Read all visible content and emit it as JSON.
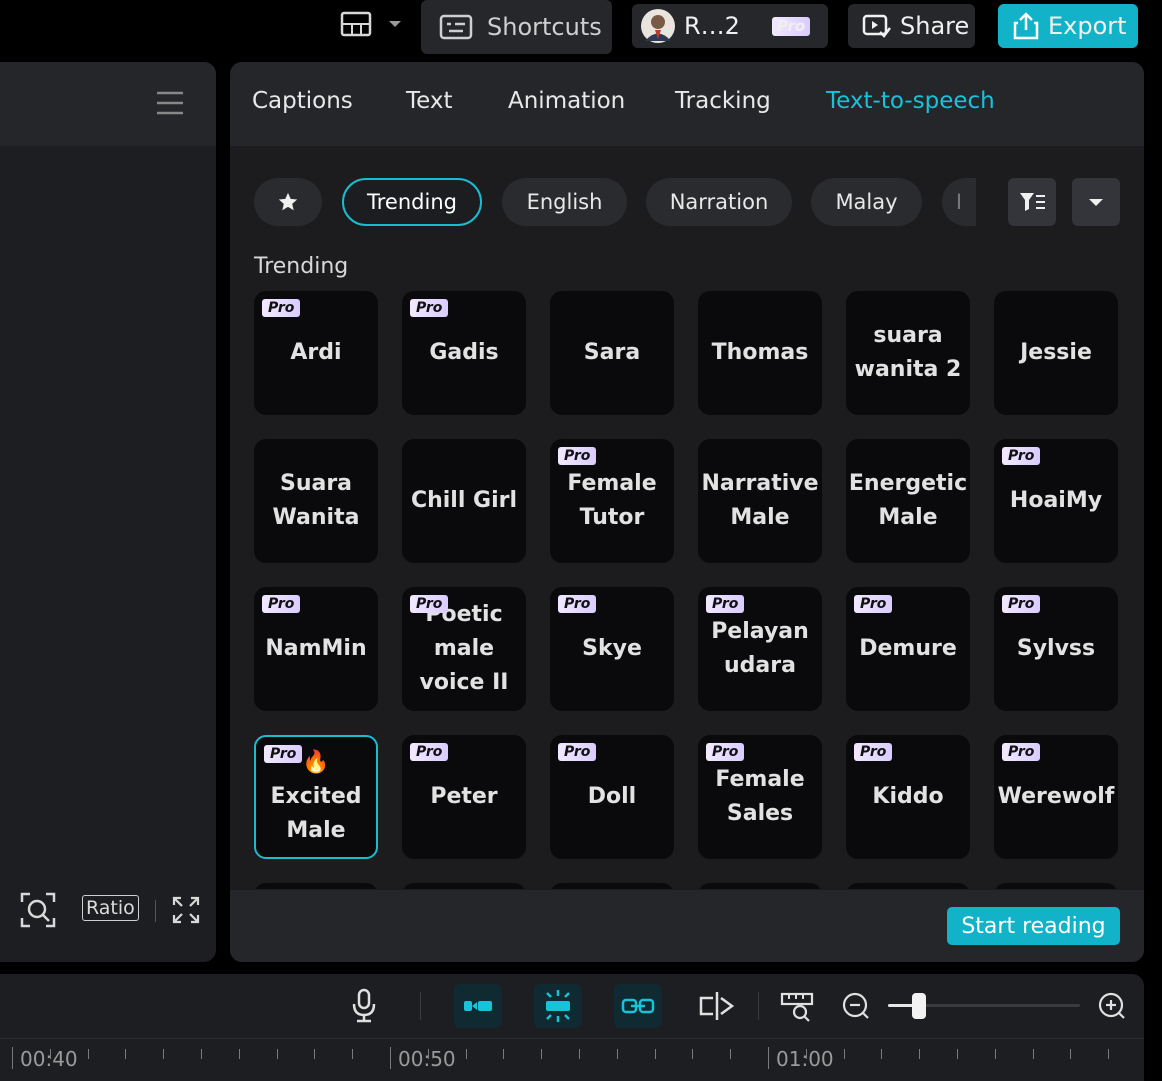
{
  "topbar": {
    "shortcuts_label": "Shortcuts",
    "account_name": "R…2",
    "pro_badge": "Pro",
    "share_label": "Share",
    "export_label": "Export"
  },
  "left_panel": {
    "ratio_label": "Ratio"
  },
  "tabs": [
    {
      "label": "Captions"
    },
    {
      "label": "Text"
    },
    {
      "label": "Animation"
    },
    {
      "label": "Tracking"
    },
    {
      "label": "Text-to-speech"
    }
  ],
  "active_tab": "Text-to-speech",
  "filters": {
    "chips": [
      {
        "label": "Trending"
      },
      {
        "label": "English"
      },
      {
        "label": "Narration"
      },
      {
        "label": "Malay"
      },
      {
        "label": "I"
      }
    ],
    "active": "Trending"
  },
  "section_title": "Trending",
  "voices": [
    {
      "name": "Ardi",
      "pro": true
    },
    {
      "name": "Gadis",
      "pro": true
    },
    {
      "name": "Sara",
      "pro": false
    },
    {
      "name": "Thomas",
      "pro": false
    },
    {
      "name": "suara wanita 2",
      "pro": false
    },
    {
      "name": "Jessie",
      "pro": false
    },
    {
      "name": "Suara Wanita",
      "pro": false
    },
    {
      "name": "Chill Girl",
      "pro": false
    },
    {
      "name": "Female Tutor",
      "pro": true
    },
    {
      "name": "Narrative Male",
      "pro": false
    },
    {
      "name": "Energetic Male",
      "pro": false
    },
    {
      "name": "HoaiMy",
      "pro": true
    },
    {
      "name": "NamMin",
      "pro": true
    },
    {
      "name": "Poetic male voice II",
      "pro": true
    },
    {
      "name": "Skye",
      "pro": true
    },
    {
      "name": "Pelayan udara",
      "pro": true
    },
    {
      "name": "Demure",
      "pro": true
    },
    {
      "name": "Sylvss",
      "pro": true
    },
    {
      "name": "🔥Excited Male",
      "pro": true,
      "selected": true
    },
    {
      "name": "Peter",
      "pro": true
    },
    {
      "name": "Doll",
      "pro": true
    },
    {
      "name": "Female Sales",
      "pro": true
    },
    {
      "name": "Kiddo",
      "pro": true
    },
    {
      "name": "Werewolf",
      "pro": true
    }
  ],
  "start_reading_label": "Start reading",
  "timeline": {
    "time_labels": [
      "00:40",
      "00:50",
      "01:00"
    ],
    "zoom_level": 0.16
  },
  "colors": {
    "accent": "#12b3c8",
    "panel": "#1c1c1f",
    "card": "#0a0a0c"
  }
}
